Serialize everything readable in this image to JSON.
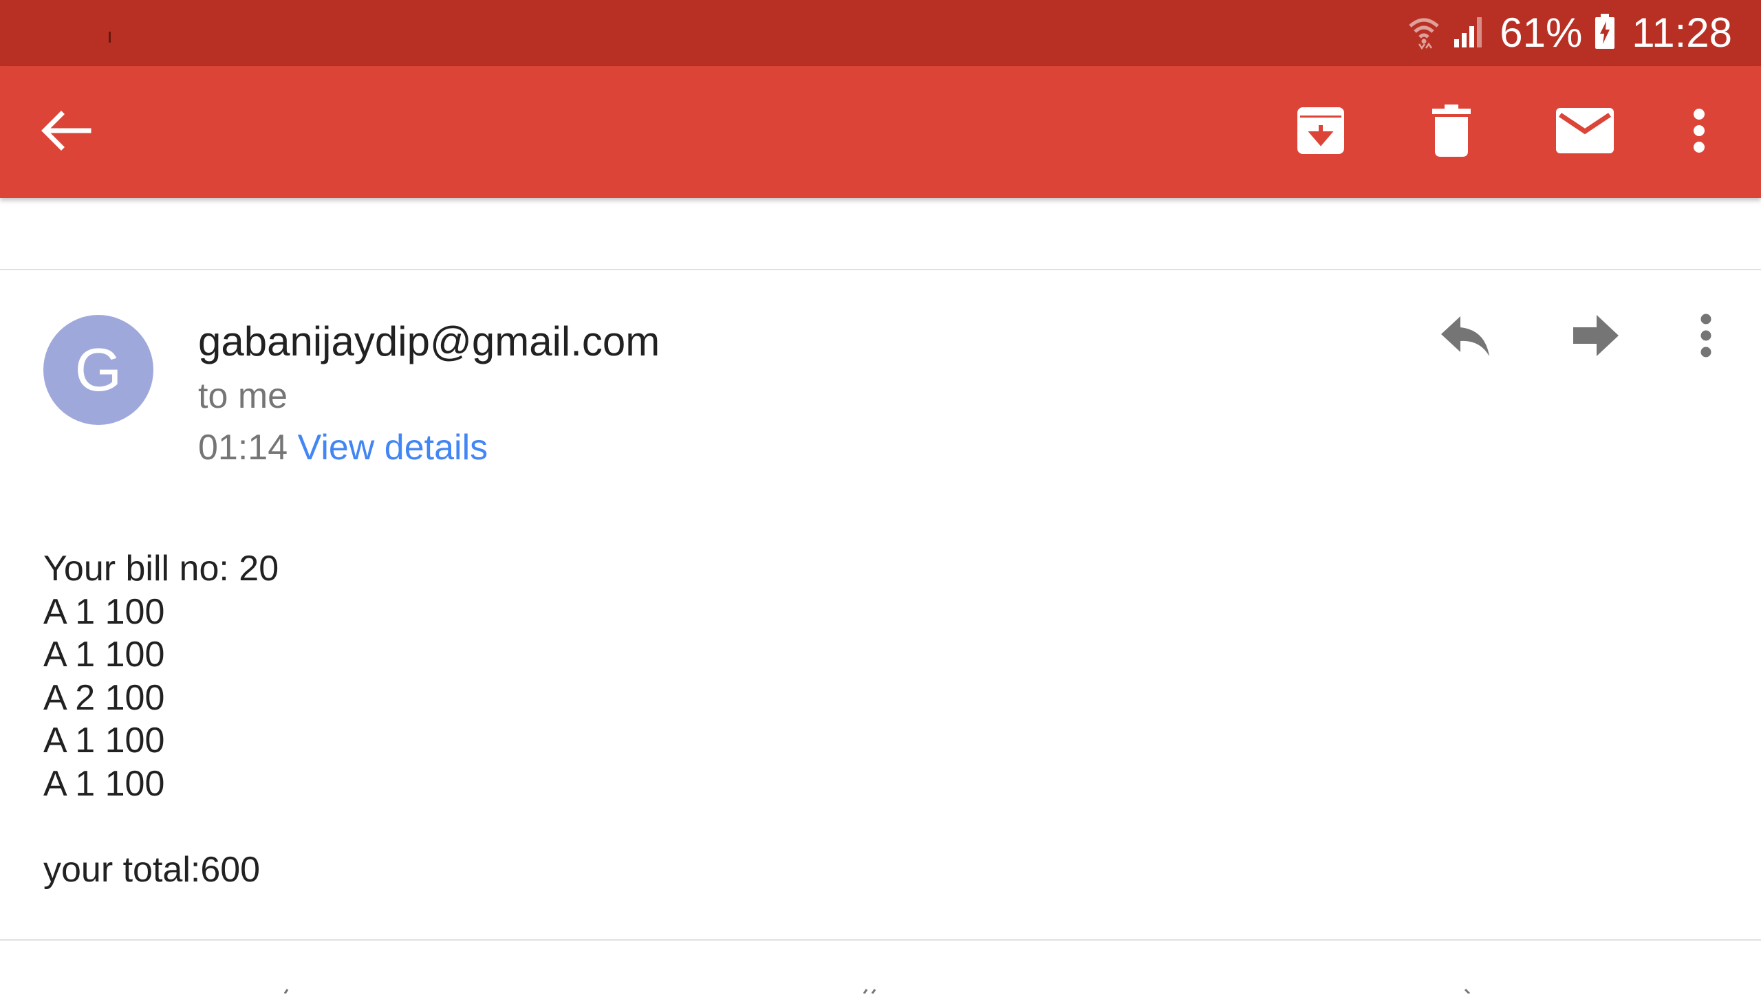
{
  "status_bar": {
    "battery_percent": "61%",
    "time": "11:28"
  },
  "toolbar": {
    "icons": [
      "back-arrow-icon",
      "archive-icon",
      "trash-icon",
      "mail-icon",
      "more-vert-icon"
    ]
  },
  "message": {
    "avatar_letter": "G",
    "sender": "gabanijaydip@gmail.com",
    "recipient": "to me",
    "time": "01:14",
    "view_details": "View details",
    "actions": [
      "reply-icon",
      "forward-icon",
      "more-vert-icon"
    ],
    "body": {
      "bill_line": "Your bill no: 20",
      "items": [
        "A 1 100",
        "A 1 100",
        "A 2 100",
        "A 1 100",
        "A 1 100"
      ],
      "total": "your total:600"
    }
  },
  "colors": {
    "status_bar": "#b83023",
    "app_bar": "#db4437",
    "avatar": "#9fa8da",
    "link": "#4285f4"
  }
}
